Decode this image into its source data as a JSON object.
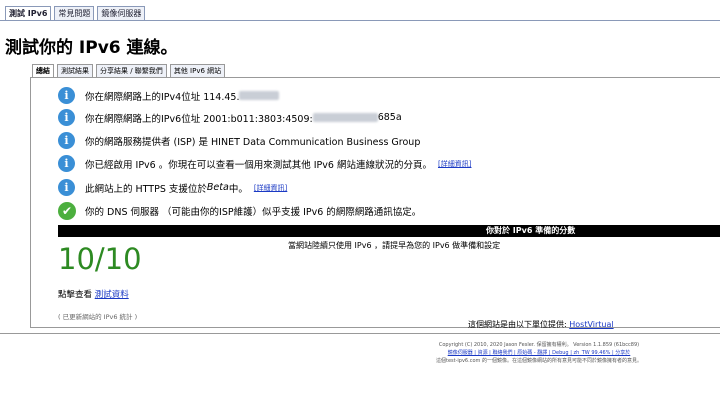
{
  "top_tabs": [
    "測試 IPv6",
    "常見問題",
    "鏡像伺服器"
  ],
  "page_title": "測試你的 IPv6 連線。",
  "sub_tabs": [
    "總結",
    "測試結果",
    "分享結果 / 聯繫我們",
    "其他 IPv6 網站"
  ],
  "rows": {
    "ipv4_prefix": "你在網際網路上的IPv4位址 114.45.",
    "ipv6_prefix": "你在網際網路上的IPv6位址 2001:b011:3803:4509:",
    "ipv6_suffix": "685a",
    "isp": "你的網路服務提供者 (ISP) 是 HINET Data Communication Business Group",
    "ipv6_enabled": "你已經啟用 IPv6 。你現在可以查看一個用來測試其他 IPv6 網站連線狀況的分頁。",
    "https_prefix": "此網站上的 HTTPS 支援位於 ",
    "https_beta": "Beta",
    "https_suffix": " 中。",
    "dns": "你的 DNS 伺服器 （可能由你的ISP維護）似乎支援 IPv6 的網際網路通訊協定。",
    "detail_link": "[詳細資訊]"
  },
  "score": {
    "header": "你對於 IPv6 準備的分數",
    "value": "10/10",
    "note": "當網站陸續只使用 IPv6 ，請提早為您的 IPv6 做準備和設定"
  },
  "click_prefix": "點擊查看 ",
  "click_link": "測試資料",
  "stats": "( 已更新網站的 IPv6 統計 )",
  "host_prefix": "這個網站是由以下單位提供: ",
  "host_link": "HostVirtual",
  "footer": {
    "copyright": "Copyright (C) 2010, 2020 Jason Fesler. 保留擁有權利。 Version 1.1.859 (61bcc89)",
    "links": "鏡像伺服器 | 資源 | 聯絡我們 | 原始碼 - 翻譯 | Debug | zh_TW 99.46% | 分享於",
    "note": "這個test-ipv6.com 的一個鏡像。在這個鏡像網站的所有意見可能不同於鏡像擁有者的意見。"
  },
  "colors": {
    "info_icon": "#3a8fd6",
    "ok_icon": "#4caf3e",
    "score": "#2d8a22",
    "link": "#1a39c4"
  }
}
